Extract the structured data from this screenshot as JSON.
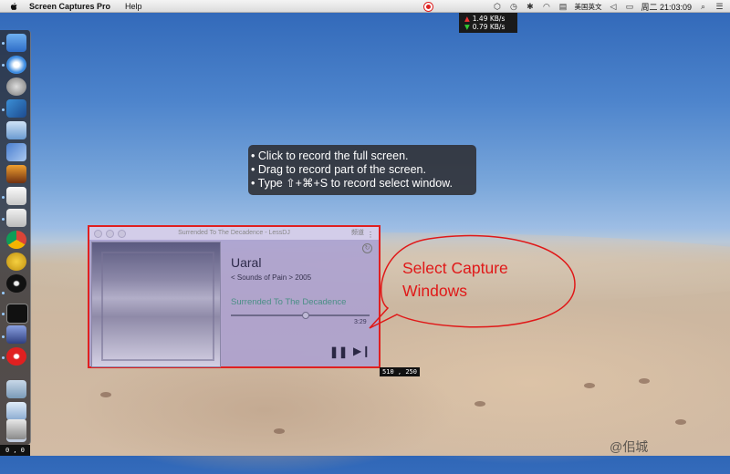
{
  "menubar": {
    "app_name": "Screen Captures Pro",
    "menu_items": [
      "Help"
    ],
    "input_method": "美国英文",
    "clock": "周二 21:03:09",
    "tray_icons": [
      "record-icon",
      "network-speed-icon",
      "dropbox-icon",
      "time-machine-icon",
      "bluetooth-icon",
      "wifi-icon",
      "flag-icon",
      "volume-icon",
      "battery-icon",
      "user-icon",
      "search-icon",
      "notification-icon"
    ]
  },
  "netspeed": {
    "up": "1.49 KB/s",
    "down": "0.79 KB/s"
  },
  "dock": {
    "icons": [
      "finder-icon",
      "safari-icon",
      "launchpad-icon",
      "xcode-icon",
      "preview-icon",
      "pencil-icon",
      "photos-icon",
      "textedit-icon",
      "chrome-icon",
      "instruments-icon",
      "record-player-icon",
      "terminal-icon",
      "photo-editor-icon",
      "screen-captures-icon",
      "folder-icon",
      "downloads-icon",
      "document-icon",
      "trash-icon"
    ]
  },
  "tooltip": {
    "lines": [
      "Click to record the full screen.",
      "Drag to record part of the screen.",
      "Type ⇧+⌘+S to record select window."
    ]
  },
  "player": {
    "window_title": "Surrended To The Decadence - LessDJ",
    "title_right": "频道",
    "artist": "Uaral",
    "album": "< Sounds of Pain > 2005",
    "song": "Surrended To The Decadence",
    "time": "3:29",
    "progress": 0.53
  },
  "capture_size": "510 , 250",
  "origin_coord": "0 , 0",
  "callout": "Select Capture\nWindows",
  "callout_lines": [
    "Select Capture",
    "Windows"
  ],
  "watermark": "@佀城",
  "colors": {
    "highlight_red": "#e02020",
    "callout_red": "#e01818"
  }
}
